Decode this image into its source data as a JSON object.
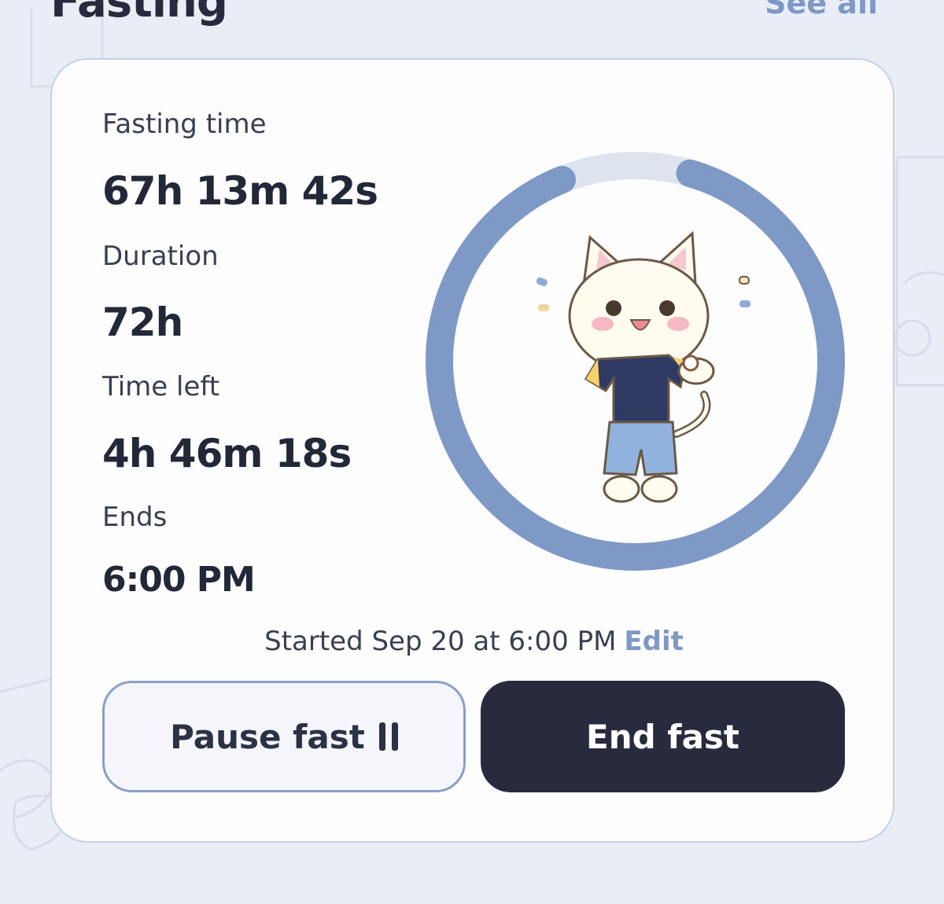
{
  "header": {
    "title": "Fasting",
    "see_all": "See all"
  },
  "card": {
    "stats": [
      {
        "label": "Fasting time",
        "value": "67h 13m 42s"
      },
      {
        "label": "Duration",
        "value": "72h"
      },
      {
        "label": "Time left",
        "value": "4h 46m 18s"
      },
      {
        "label": "Ends",
        "value": "6:00 PM"
      }
    ],
    "progress": {
      "fraction": 0.934,
      "track_color": "#dde4ee",
      "fill_color": "#7f99c6",
      "illustration": "cat-checking-watch-illustration"
    },
    "started_text": "Started Sep 20 at 6:00 PM",
    "edit_label": "Edit",
    "pause_button": "Pause fast",
    "pause_icon": "pause-icon",
    "end_button": "End fast"
  },
  "colors": {
    "accent": "#7f99c6",
    "dark_button": "#282b3e",
    "background": "#e9edf5"
  }
}
